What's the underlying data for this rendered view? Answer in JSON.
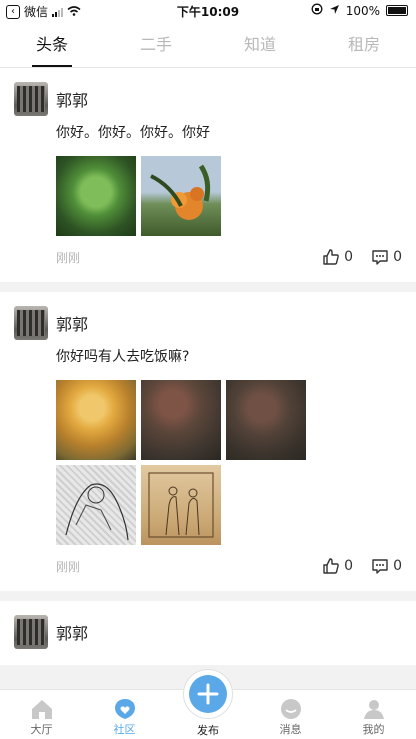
{
  "status_bar": {
    "back_app": "微信",
    "time": "下午10:09",
    "battery": "100%"
  },
  "tabs": [
    {
      "label": "头条",
      "active": true
    },
    {
      "label": "二手",
      "active": false
    },
    {
      "label": "知道",
      "active": false
    },
    {
      "label": "租房",
      "active": false
    }
  ],
  "posts": [
    {
      "author": "郭郭",
      "content": "你好。你好。你好。你好",
      "time": "刚刚",
      "likes": "0",
      "comments": "0",
      "images": [
        "t1",
        "t2"
      ]
    },
    {
      "author": "郭郭",
      "content": "你好吗有人去吃饭嘛?",
      "time": "刚刚",
      "likes": "0",
      "comments": "0",
      "images": [
        "t3",
        "t4",
        "t5",
        "t6",
        "t7"
      ]
    },
    {
      "author": "郭郭"
    }
  ],
  "bottom_nav": {
    "items": [
      {
        "label": "大厅",
        "icon": "house-icon",
        "active": false
      },
      {
        "label": "社区",
        "icon": "community-icon",
        "active": true
      },
      {
        "label": "消息",
        "icon": "message-icon",
        "active": false
      },
      {
        "label": "我的",
        "icon": "profile-icon",
        "active": false
      }
    ],
    "publish_label": "发布",
    "accent": "#5aa8e8"
  }
}
